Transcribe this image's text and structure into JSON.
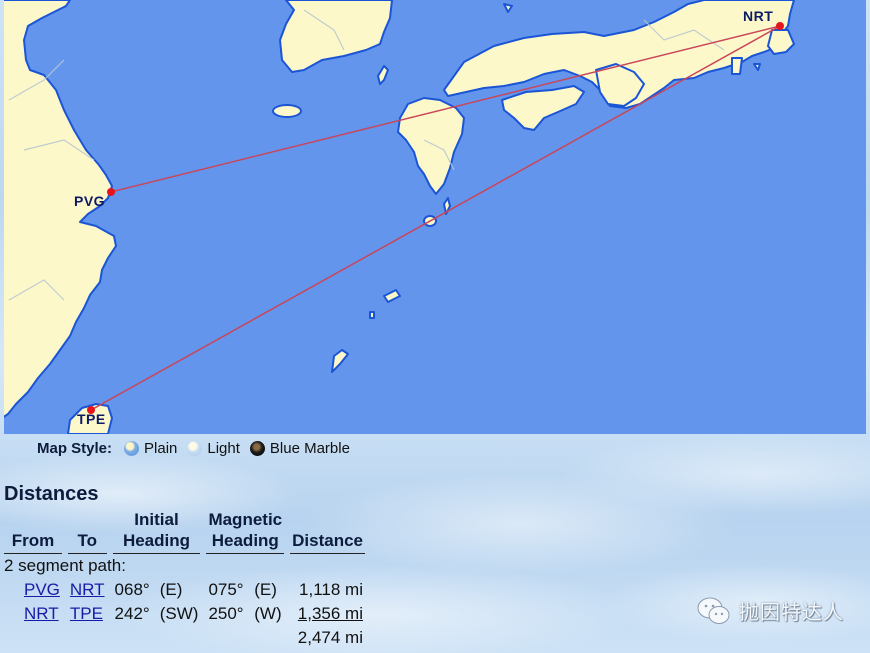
{
  "map": {
    "colors": {
      "ocean": "#6495ed",
      "land": "#fdf8c9",
      "coast": "#1a55d6",
      "route": "#c8465a",
      "airport": "#e8141c"
    },
    "airports": [
      {
        "code": "NRT",
        "role": "origin-destination"
      },
      {
        "code": "PVG",
        "role": "origin"
      },
      {
        "code": "TPE",
        "role": "destination"
      }
    ],
    "routes": [
      {
        "from": "PVG",
        "to": "NRT"
      },
      {
        "from": "NRT",
        "to": "TPE"
      }
    ]
  },
  "map_style": {
    "label": "Map Style:",
    "options": [
      {
        "label": "Plain",
        "icon": "globe-plain-icon"
      },
      {
        "label": "Light",
        "icon": "globe-light-icon"
      },
      {
        "label": "Blue Marble",
        "icon": "globe-blue-marble-icon"
      }
    ]
  },
  "distances": {
    "title": "Distances",
    "headers": {
      "from": "From",
      "to": "To",
      "initial_line1": "Initial",
      "initial_line2": "Heading",
      "magnetic_line1": "Magnetic",
      "magnetic_line2": "Heading",
      "distance": "Distance"
    },
    "path_label": "2 segment path:",
    "rows": [
      {
        "from": "PVG",
        "to": "NRT",
        "initial_deg": "068°",
        "initial_dir": "(E)",
        "magnetic_deg": "075°",
        "magnetic_dir": "(E)",
        "distance": "1,118 mi"
      },
      {
        "from": "NRT",
        "to": "TPE",
        "initial_deg": "242°",
        "initial_dir": "(SW)",
        "magnetic_deg": "250°",
        "magnetic_dir": "(W)",
        "distance": "1,356 mi"
      }
    ],
    "total": "2,474 mi"
  },
  "watermark": {
    "text": "抛因特达人",
    "icon": "wechat-icon"
  }
}
